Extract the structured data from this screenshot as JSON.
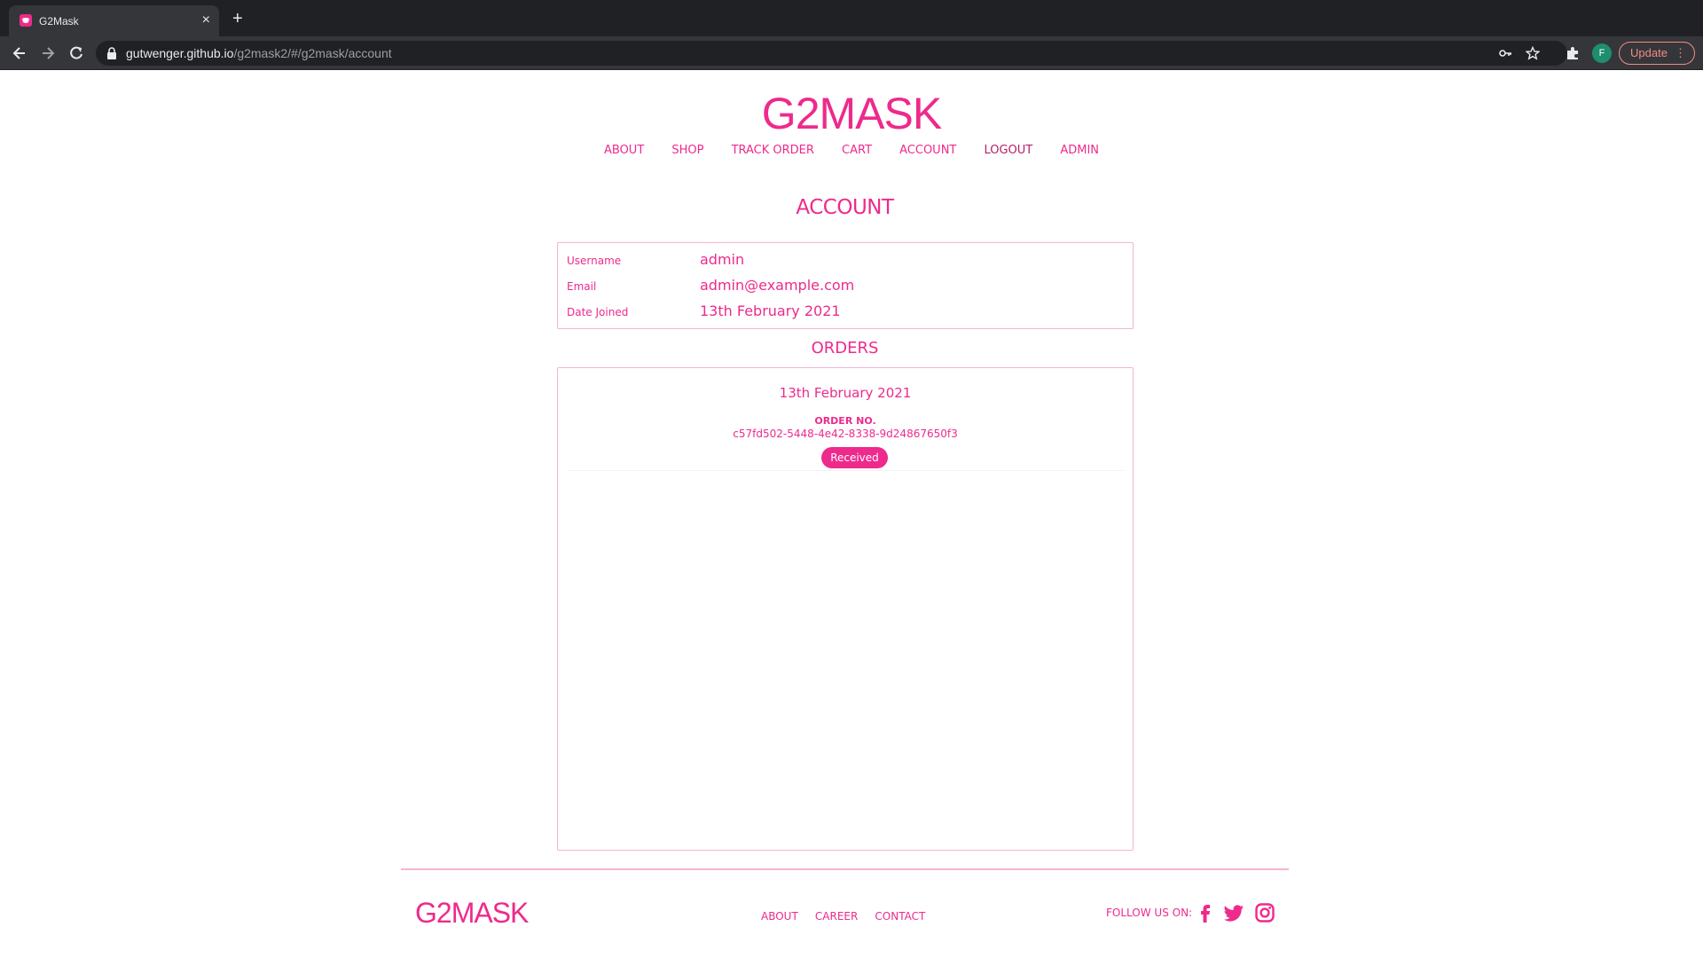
{
  "browser": {
    "tab_title": "G2Mask",
    "tab_close": "×",
    "new_tab": "+",
    "url_host": "gutwenger.github.io",
    "url_path": "/g2mask2/#/g2mask/account",
    "avatar_letter": "F",
    "update_label": "Update",
    "update_menu": "⋮"
  },
  "site": {
    "logo": "G2MASK",
    "nav": [
      "ABOUT",
      "SHOP",
      "TRACK ORDER",
      "CART",
      "ACCOUNT",
      "LOGOUT",
      "ADMIN"
    ]
  },
  "account": {
    "heading": "ACCOUNT",
    "fields": [
      {
        "label": "Username",
        "value": "admin"
      },
      {
        "label": "Email",
        "value": "admin@example.com"
      },
      {
        "label": "Date Joined",
        "value": "13th February 2021"
      }
    ]
  },
  "orders": {
    "heading": "ORDERS",
    "items": [
      {
        "date": "13th February 2021",
        "number_label": "ORDER NO.",
        "number": "c57fd502-5448-4e42-8338-9d24867650f3",
        "status": "Received"
      }
    ]
  },
  "footer": {
    "logo": "G2MASK",
    "links": [
      "ABOUT",
      "CAREER",
      "CONTACT"
    ],
    "follow_label": "FOLLOW US ON:",
    "social_icons": [
      "facebook-icon",
      "twitter-icon",
      "instagram-icon"
    ]
  },
  "colors": {
    "brand": "#ee2a8c",
    "border": "#f6b3d3"
  }
}
